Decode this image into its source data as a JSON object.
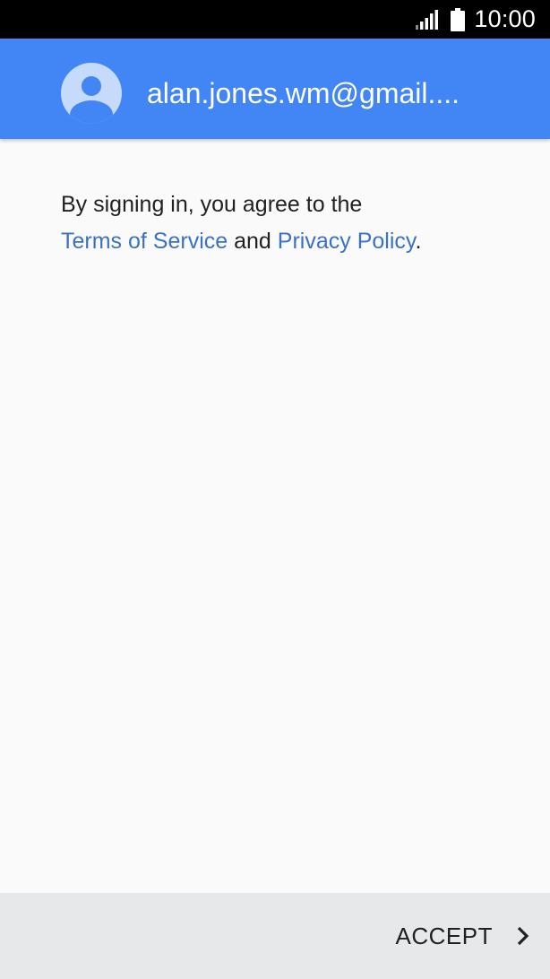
{
  "status_bar": {
    "time": "10:00",
    "signal_icon": "signal-icon",
    "battery_icon": "battery-icon"
  },
  "header": {
    "avatar_icon": "avatar-icon",
    "account_email": "alan.jones.wm@gmail...."
  },
  "terms": {
    "prefix": "By signing in, you agree to the",
    "terms_link": "Terms of Service",
    "conjunction": "and",
    "privacy_link": "Privacy Policy",
    "suffix": "."
  },
  "footer": {
    "accept_label": "ACCEPT",
    "accept_icon": "chevron-right-icon"
  },
  "colors": {
    "header_bg": "#4285f4",
    "link": "#3b72c4",
    "footer_bg": "#e6e8ea",
    "status_bar_bg": "#000000"
  }
}
